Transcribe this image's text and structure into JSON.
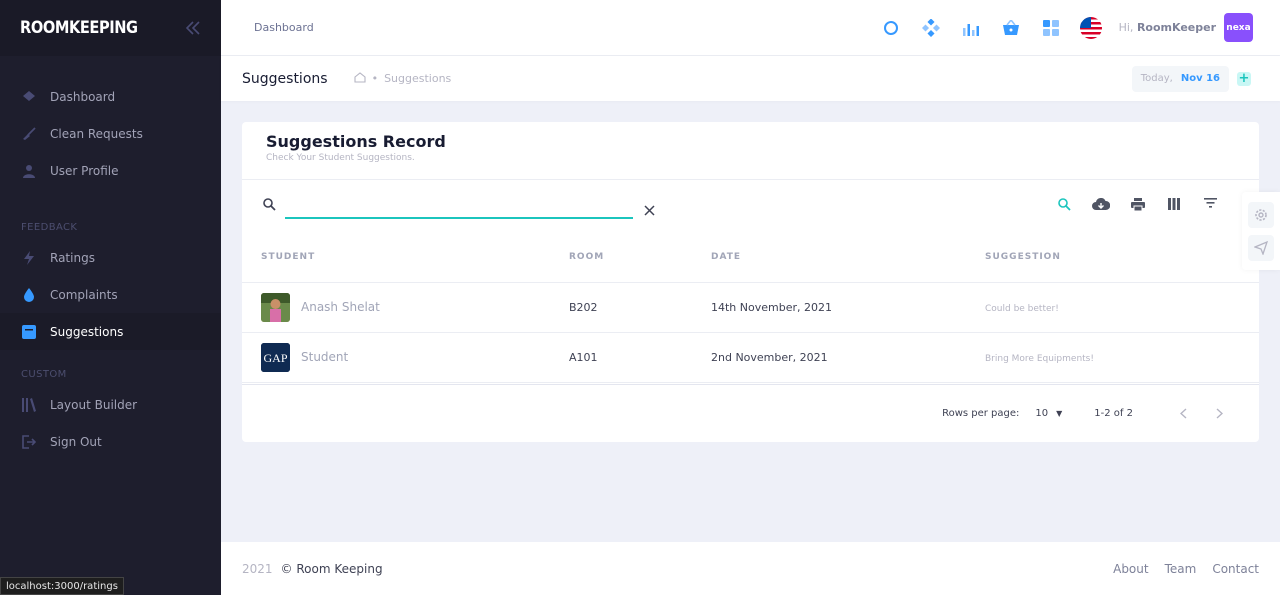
{
  "sidebar": {
    "brand": "ROOMKEEPING",
    "items": [
      {
        "label": "Dashboard",
        "icon": "layers-icon"
      },
      {
        "label": "Clean Requests",
        "icon": "broom-icon"
      },
      {
        "label": "User Profile",
        "icon": "user-icon"
      }
    ],
    "feedback_section": "FEEDBACK",
    "feedback_items": [
      {
        "label": "Ratings",
        "icon": "lightning-icon"
      },
      {
        "label": "Complaints",
        "icon": "drop-icon"
      },
      {
        "label": "Suggestions",
        "icon": "note-icon",
        "active": true
      }
    ],
    "custom_section": "CUSTOM",
    "custom_items": [
      {
        "label": "Layout Builder",
        "icon": "library-icon"
      },
      {
        "label": "Sign Out",
        "icon": "sign-out-icon"
      }
    ]
  },
  "header": {
    "tab": "Dashboard",
    "greeting": "Hi,",
    "username": "RoomKeeper",
    "avatar_text": "nexa",
    "icons": [
      "circle-search-icon",
      "diamond-icon",
      "chart-icon",
      "basket-icon",
      "grid-icon",
      "us-flag-icon"
    ]
  },
  "subheader": {
    "title": "Suggestions",
    "breadcrumb": "Suggestions",
    "today_label": "Today,",
    "today_date": "Nov 16",
    "plus": "+"
  },
  "card": {
    "title": "Suggestions Record",
    "subtitle": "Check Your Student Suggestions.",
    "search_placeholder": "",
    "columns": [
      "STUDENT",
      "ROOM",
      "DATE",
      "SUGGESTION"
    ],
    "rows": [
      {
        "student": "Anash Shelat",
        "room": "B202",
        "date": "14th November, 2021",
        "suggestion": "Could be better!"
      },
      {
        "student": "Student",
        "room": "A101",
        "date": "2nd November, 2021",
        "suggestion": "Bring More Equipments!"
      }
    ],
    "logo_text": "GAP"
  },
  "pagination": {
    "rows_per_page_label": "Rows per page:",
    "rows_per_page": "10",
    "range": "1-2 of 2"
  },
  "footer": {
    "year": "2021",
    "copyright": "© Room Keeping",
    "links": [
      "About",
      "Team",
      "Contact"
    ]
  },
  "status_url": "localhost:3000/ratings",
  "colors": {
    "sidebar": "#1e1e2d",
    "accent": "#1bc5bd",
    "primary": "#3699ff",
    "avatar": "#8950fc"
  }
}
